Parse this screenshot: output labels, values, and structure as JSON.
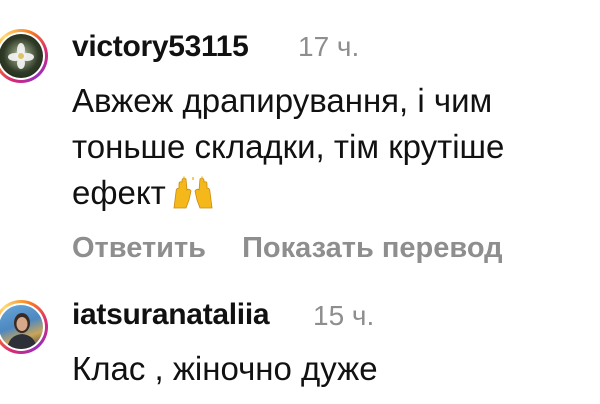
{
  "comments": [
    {
      "username": "victory53115",
      "time": "17 ч.",
      "text": "Авжеж драпирування, і чим\nтоньше складки, тім крутіше\nефект",
      "emoji": "raising-hands",
      "actions": {
        "reply": "Ответить",
        "translate": "Показать перевод"
      }
    },
    {
      "username": "iatsuranataliia",
      "time": "15 ч.",
      "text": "Клас , жіночно дуже"
    }
  ],
  "colors": {
    "text": "#111111",
    "muted": "#8e8e8e",
    "ring": [
      "#d62976",
      "#fa7e1e",
      "#feda75"
    ]
  }
}
